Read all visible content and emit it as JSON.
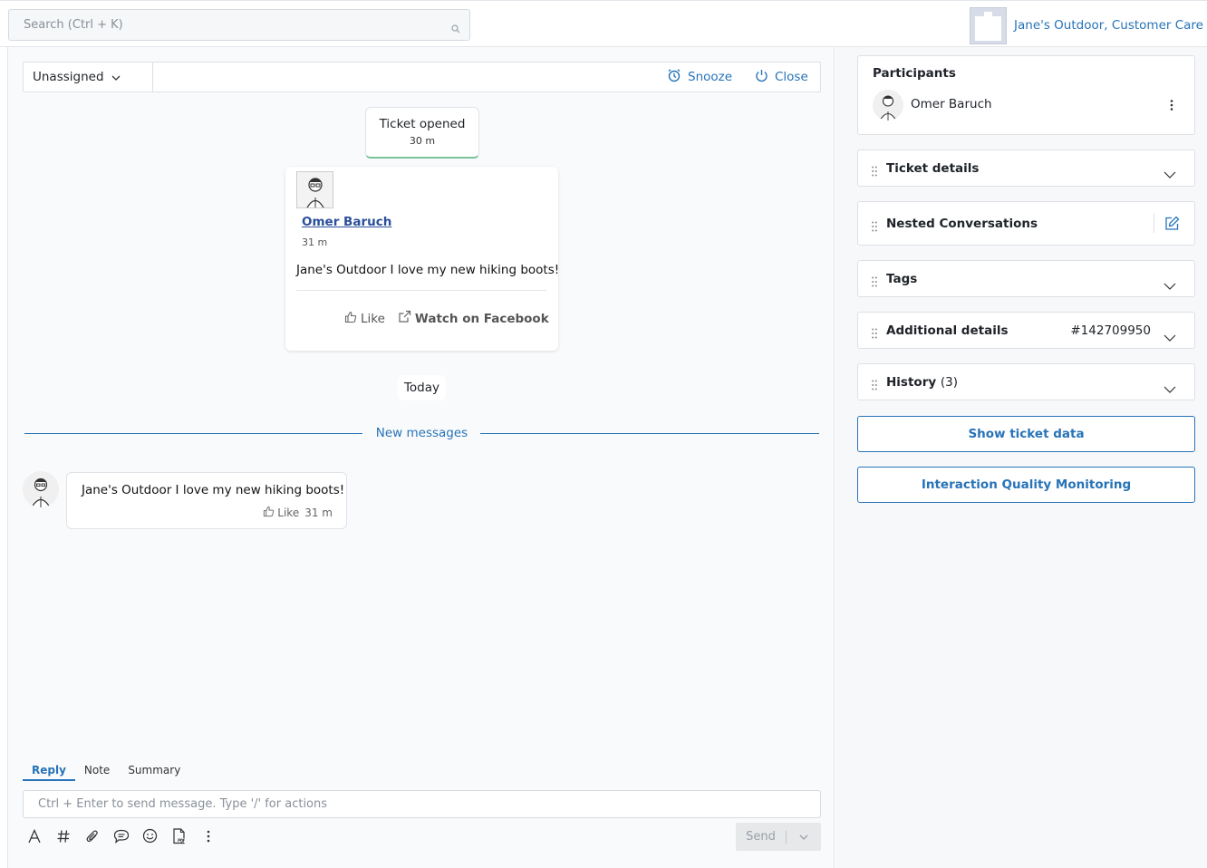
{
  "search": {
    "placeholder": "Search (Ctrl + K)"
  },
  "account": {
    "name": "Jane's Outdoor, Customer Care"
  },
  "toolbar": {
    "assign_label": "Unassigned",
    "snooze_label": "Snooze",
    "close_label": "Close"
  },
  "timeline": {
    "opened_title": "Ticket opened",
    "opened_time": "30 m",
    "post": {
      "author": "Omer Baruch",
      "time": "31 m",
      "message": "Jane's Outdoor I love my new hiking boots!",
      "like_label": "Like",
      "watch_label": "Watch on Facebook"
    },
    "day_label": "Today",
    "new_messages_label": "New messages",
    "reply": {
      "message": "Jane's Outdoor I love my new hiking boots!",
      "like_label": "Like",
      "time": "31 m"
    }
  },
  "composer": {
    "tabs": [
      "Reply",
      "Note",
      "Summary"
    ],
    "active_tab": "Reply",
    "placeholder": "Ctrl + Enter to send message. Type '/' for actions",
    "send_label": "Send",
    "tools": [
      "text-format-icon",
      "hashtag-icon",
      "paperclip-icon",
      "chat-bubble-icon",
      "emoji-icon",
      "pdf-icon",
      "more-vertical-icon"
    ]
  },
  "sidebar": {
    "participants_title": "Participants",
    "participant_name": "Omer Baruch",
    "sections": {
      "ticket_details": "Ticket details",
      "nested": "Nested Conversations",
      "tags": "Tags",
      "additional": "Additional details",
      "additional_id": "#142709950",
      "history": "History",
      "history_count": "(3)"
    },
    "show_ticket_data": "Show ticket data",
    "iqm": "Interaction Quality Monitoring"
  },
  "colors": {
    "accent": "#2773b8",
    "author_link": "#2a4f9a",
    "opened_border": "#7ac29a"
  }
}
